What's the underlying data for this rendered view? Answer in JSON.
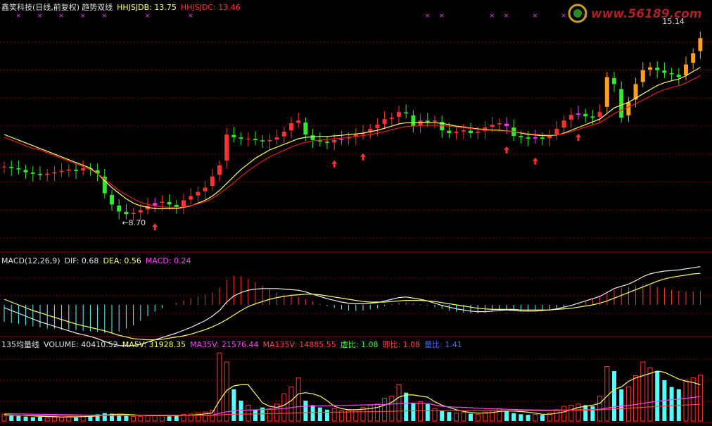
{
  "header": {
    "title": "鑫笑科技(日线,前复权)",
    "indicator": "趋势双线",
    "hhjsjdb": "HHJSJDB: 13.75",
    "hhjsjdc": "HHJSJDC: 13.46"
  },
  "macd_header": {
    "name": "MACD(12,26,9)",
    "dif": "DIF: 0.68",
    "dea": "DEA: 0.56",
    "macd": "MACD: 0.24"
  },
  "vol_header": {
    "name": "135均量线",
    "volume": "VOLUME: 40410.52",
    "ma5v": "MA5V: 31928.35",
    "ma35v": "MA35V: 21576.44",
    "ma135v": "MA135V: 14885.55",
    "xubi": "虚比: 1.08",
    "jibi": "即比: 1.08",
    "liangbi": "量比: 1.41"
  },
  "watermark": "www.56189.com",
  "colors": {
    "up": "#ff3232",
    "down": "#54ffff",
    "green_candle": "#33e833",
    "magenta": "#ff33ff",
    "orange": "#ffa020",
    "yellow_line": "#ffff66",
    "red_line": "#e02020",
    "grid": "#7a0000",
    "header_white": "#e0e0e0"
  },
  "chart_data": [
    {
      "type": "candlestick",
      "panel": "price",
      "annotations": [
        {
          "text": "8.70",
          "label": "low"
        },
        {
          "text": "15.14",
          "label": "high"
        }
      ],
      "series": [
        {
          "name": "HHJSJDB",
          "last": 13.75
        },
        {
          "name": "HHJSJDC",
          "last": 13.46
        }
      ],
      "ylim": [
        7.5,
        16.0
      ],
      "close": [
        10.55,
        10.5,
        10.45,
        10.35,
        10.3,
        10.25,
        10.3,
        10.35,
        10.4,
        10.45,
        10.4,
        10.5,
        10.45,
        10.3,
        9.6,
        9.2,
        8.95,
        8.85,
        8.9,
        9.0,
        9.15,
        9.25,
        9.3,
        9.2,
        9.1,
        9.35,
        9.5,
        9.65,
        9.8,
        10.2,
        10.6,
        11.7,
        11.6,
        11.55,
        11.55,
        11.5,
        11.45,
        11.5,
        11.6,
        11.8,
        12.1,
        12.2,
        11.7,
        11.5,
        11.45,
        11.4,
        11.5,
        11.55,
        11.6,
        11.7,
        11.75,
        11.9,
        12.05,
        12.25,
        12.3,
        12.5,
        12.45,
        12.0,
        12.2,
        12.15,
        12.2,
        11.85,
        11.75,
        11.8,
        11.85,
        11.75,
        11.8,
        11.95,
        12.05,
        12.1,
        12.0,
        11.65,
        11.6,
        11.55,
        11.6,
        11.55,
        11.65,
        11.9,
        12.2,
        12.4,
        12.45,
        12.35,
        12.3,
        12.5,
        13.75,
        13.5,
        12.3,
        12.85,
        13.5,
        14.0,
        14.1,
        14.0,
        13.9,
        13.85,
        13.75,
        14.2,
        14.6,
        15.14
      ],
      "hhjsjdb": [
        11.7,
        11.6,
        11.5,
        11.4,
        11.3,
        11.2,
        11.1,
        11.0,
        10.9,
        10.8,
        10.7,
        10.6,
        10.5,
        10.3,
        10.05,
        9.8,
        9.6,
        9.4,
        9.25,
        9.15,
        9.1,
        9.05,
        9.05,
        9.05,
        9.05,
        9.1,
        9.15,
        9.25,
        9.35,
        9.5,
        9.7,
        9.95,
        10.2,
        10.45,
        10.65,
        10.85,
        11.0,
        11.15,
        11.25,
        11.35,
        11.45,
        11.55,
        11.6,
        11.62,
        11.63,
        11.63,
        11.65,
        11.67,
        11.7,
        11.72,
        11.75,
        11.8,
        11.85,
        11.92,
        12.0,
        12.08,
        12.12,
        12.12,
        12.13,
        12.13,
        12.12,
        12.1,
        12.05,
        12.0,
        11.97,
        11.93,
        11.9,
        11.88,
        11.86,
        11.85,
        11.83,
        11.8,
        11.75,
        11.7,
        11.68,
        11.66,
        11.66,
        11.68,
        11.75,
        11.85,
        11.95,
        12.05,
        12.15,
        12.25,
        12.45,
        12.65,
        12.75,
        12.85,
        13.0,
        13.15,
        13.3,
        13.45,
        13.55,
        13.62,
        13.68,
        13.8,
        13.95,
        14.1
      ],
      "hhjsjdc": [
        11.6,
        11.5,
        11.4,
        11.3,
        11.2,
        11.15,
        11.05,
        10.95,
        10.85,
        10.75,
        10.65,
        10.55,
        10.45,
        10.3,
        10.1,
        9.9,
        9.7,
        9.55,
        9.4,
        9.28,
        9.2,
        9.15,
        9.12,
        9.1,
        9.1,
        9.12,
        9.16,
        9.22,
        9.3,
        9.42,
        9.58,
        9.78,
        9.98,
        10.2,
        10.4,
        10.58,
        10.75,
        10.9,
        11.02,
        11.14,
        11.25,
        11.35,
        11.42,
        11.47,
        11.5,
        11.52,
        11.55,
        11.57,
        11.6,
        11.63,
        11.66,
        11.7,
        11.75,
        11.8,
        11.87,
        11.93,
        11.98,
        12.0,
        12.02,
        12.03,
        12.03,
        12.02,
        12.0,
        11.97,
        11.94,
        11.91,
        11.88,
        11.86,
        11.84,
        11.83,
        11.82,
        11.8,
        11.77,
        11.73,
        11.71,
        11.69,
        11.68,
        11.69,
        11.73,
        11.8,
        11.88,
        11.96,
        12.04,
        12.12,
        12.28,
        12.45,
        12.57,
        12.68,
        12.8,
        12.93,
        13.06,
        13.2,
        13.3,
        13.38,
        13.44,
        13.54,
        13.67,
        13.8
      ]
    },
    {
      "type": "bar",
      "panel": "macd",
      "dif_last": 0.68,
      "dea_last": 0.56,
      "macd_last": 0.24,
      "macd": [
        -0.3,
        -0.32,
        -0.34,
        -0.36,
        -0.38,
        -0.4,
        -0.42,
        -0.42,
        -0.44,
        -0.44,
        -0.45,
        -0.46,
        -0.47,
        -0.48,
        -0.5,
        -0.5,
        -0.47,
        -0.42,
        -0.36,
        -0.28,
        -0.2,
        -0.12,
        -0.06,
        0.0,
        0.04,
        0.08,
        0.12,
        0.15,
        0.18,
        0.22,
        0.3,
        0.45,
        0.52,
        0.5,
        0.46,
        0.4,
        0.34,
        0.28,
        0.22,
        0.18,
        0.16,
        0.14,
        0.1,
        0.06,
        0.02,
        -0.02,
        -0.05,
        -0.08,
        -0.1,
        -0.11,
        -0.1,
        -0.08,
        -0.06,
        -0.02,
        0.02,
        0.04,
        0.05,
        0.03,
        0.01,
        -0.01,
        -0.04,
        -0.07,
        -0.1,
        -0.12,
        -0.14,
        -0.15,
        -0.15,
        -0.14,
        -0.12,
        -0.1,
        -0.09,
        -0.1,
        -0.11,
        -0.11,
        -0.1,
        -0.09,
        -0.08,
        -0.06,
        -0.04,
        -0.02,
        0.02,
        0.06,
        0.1,
        0.14,
        0.2,
        0.26,
        0.3,
        0.32,
        0.34,
        0.36,
        0.35,
        0.32,
        0.3,
        0.27,
        0.25,
        0.24,
        0.24,
        0.24
      ],
      "dif": [
        -0.05,
        -0.1,
        -0.15,
        -0.2,
        -0.25,
        -0.3,
        -0.34,
        -0.38,
        -0.42,
        -0.46,
        -0.5,
        -0.53,
        -0.56,
        -0.6,
        -0.65,
        -0.69,
        -0.72,
        -0.73,
        -0.72,
        -0.7,
        -0.66,
        -0.62,
        -0.58,
        -0.54,
        -0.5,
        -0.45,
        -0.4,
        -0.34,
        -0.28,
        -0.2,
        -0.1,
        0.05,
        0.16,
        0.22,
        0.26,
        0.28,
        0.29,
        0.29,
        0.29,
        0.28,
        0.27,
        0.26,
        0.23,
        0.19,
        0.15,
        0.11,
        0.08,
        0.05,
        0.03,
        0.02,
        0.02,
        0.03,
        0.04,
        0.07,
        0.1,
        0.13,
        0.14,
        0.12,
        0.1,
        0.07,
        0.03,
        -0.01,
        -0.04,
        -0.07,
        -0.09,
        -0.11,
        -0.12,
        -0.12,
        -0.11,
        -0.1,
        -0.09,
        -0.1,
        -0.11,
        -0.11,
        -0.11,
        -0.1,
        -0.09,
        -0.07,
        -0.04,
        -0.01,
        0.03,
        0.07,
        0.11,
        0.15,
        0.22,
        0.29,
        0.33,
        0.37,
        0.43,
        0.5,
        0.55,
        0.58,
        0.6,
        0.61,
        0.62,
        0.64,
        0.66,
        0.68
      ],
      "dea": [
        0.1,
        0.05,
        0.0,
        -0.05,
        -0.1,
        -0.14,
        -0.18,
        -0.22,
        -0.26,
        -0.3,
        -0.34,
        -0.37,
        -0.4,
        -0.43,
        -0.46,
        -0.5,
        -0.54,
        -0.57,
        -0.6,
        -0.61,
        -0.62,
        -0.62,
        -0.61,
        -0.59,
        -0.57,
        -0.55,
        -0.52,
        -0.48,
        -0.44,
        -0.39,
        -0.33,
        -0.26,
        -0.18,
        -0.1,
        -0.03,
        0.02,
        0.06,
        0.1,
        0.13,
        0.15,
        0.17,
        0.18,
        0.19,
        0.19,
        0.18,
        0.16,
        0.14,
        0.12,
        0.1,
        0.08,
        0.06,
        0.05,
        0.05,
        0.05,
        0.06,
        0.07,
        0.08,
        0.08,
        0.08,
        0.07,
        0.06,
        0.04,
        0.02,
        0.0,
        -0.02,
        -0.04,
        -0.06,
        -0.07,
        -0.08,
        -0.08,
        -0.08,
        -0.08,
        -0.09,
        -0.09,
        -0.09,
        -0.09,
        -0.09,
        -0.08,
        -0.07,
        -0.06,
        -0.04,
        -0.02,
        0.0,
        0.03,
        0.07,
        0.12,
        0.17,
        0.22,
        0.27,
        0.32,
        0.37,
        0.42,
        0.46,
        0.49,
        0.51,
        0.53,
        0.55,
        0.56
      ]
    },
    {
      "type": "bar",
      "panel": "volume",
      "volume_last": 40410.52,
      "ma5v_last": 31928.35,
      "ma35v_last": 21576.44,
      "ma135v_last": 14885.55,
      "volume": [
        6000,
        5000,
        4500,
        4000,
        3500,
        3800,
        3000,
        4000,
        3500,
        3800,
        3200,
        5000,
        4200,
        6000,
        7000,
        6500,
        5500,
        4500,
        4000,
        4200,
        4600,
        5000,
        4800,
        4200,
        4500,
        6000,
        6200,
        7000,
        8000,
        9500,
        60000,
        52000,
        28000,
        18000,
        14000,
        10000,
        12000,
        11000,
        15000,
        24000,
        30000,
        38000,
        18000,
        14000,
        12000,
        10000,
        11000,
        9000,
        9500,
        10000,
        12000,
        14000,
        15000,
        20000,
        22000,
        32000,
        25000,
        16000,
        17000,
        15000,
        11000,
        9000,
        8000,
        7000,
        7500,
        6500,
        6000,
        8000,
        9000,
        11000,
        9000,
        7000,
        6000,
        5500,
        6000,
        5500,
        7000,
        10000,
        13000,
        14000,
        15000,
        14000,
        13000,
        22000,
        48000,
        44000,
        28000,
        30000,
        40000,
        52000,
        47000,
        44000,
        36000,
        30000,
        28000,
        36000,
        38000,
        40410
      ],
      "ma5v": [
        5500,
        5400,
        5200,
        4800,
        4600,
        4300,
        4000,
        3800,
        3600,
        3700,
        3700,
        3900,
        4100,
        4500,
        5200,
        5800,
        6100,
        5900,
        5500,
        5100,
        4800,
        4700,
        4700,
        4800,
        4700,
        5000,
        5200,
        5700,
        6300,
        7200,
        18000,
        27000,
        31000,
        32000,
        32000,
        24000,
        16000,
        13000,
        12000,
        14000,
        18000,
        24000,
        25000,
        24000,
        22000,
        18000,
        13000,
        11000,
        10000,
        10000,
        10400,
        11000,
        12000,
        14000,
        16500,
        21000,
        23000,
        23000,
        22000,
        21000,
        17000,
        14000,
        12000,
        10000,
        8500,
        7500,
        7000,
        7000,
        7500,
        8500,
        8800,
        8800,
        8400,
        7800,
        7000,
        6000,
        6000,
        7000,
        8000,
        10000,
        12000,
        13000,
        14000,
        15600,
        22000,
        28000,
        30000,
        35000,
        38000,
        40000,
        42000,
        44000,
        43000,
        40000,
        37000,
        35000,
        34000,
        31928
      ],
      "ma35v": [
        6500,
        6400,
        6300,
        6200,
        6100,
        6000,
        5900,
        5800,
        5700,
        5600,
        5500,
        5400,
        5300,
        5300,
        5300,
        5300,
        5200,
        5200,
        5100,
        5100,
        5000,
        5000,
        5000,
        5000,
        5000,
        5000,
        5000,
        5100,
        5200,
        5300,
        6800,
        8200,
        9000,
        9400,
        9700,
        9900,
        10100,
        10300,
        10600,
        11100,
        11800,
        12700,
        13000,
        13200,
        13400,
        13500,
        13700,
        13800,
        13900,
        14000,
        14200,
        14300,
        14500,
        14700,
        15000,
        15500,
        15800,
        15800,
        15800,
        15600,
        14200,
        13000,
        12600,
        12300,
        12100,
        11700,
        11300,
        11000,
        10800,
        10600,
        10400,
        10200,
        10000,
        9900,
        9800,
        9700,
        9700,
        9700,
        9700,
        9800,
        9900,
        10000,
        10100,
        10400,
        11500,
        12600,
        13200,
        13800,
        14600,
        15700,
        16600,
        17500,
        18200,
        18800,
        19300,
        20100,
        20800,
        21576
      ],
      "ma135v": [
        5000,
        5000,
        5000,
        5000,
        5000,
        5000,
        5000,
        5000,
        5000,
        5000,
        5000,
        5000,
        5000,
        5000,
        5000,
        5000,
        5000,
        5000,
        5000,
        5000,
        5000,
        5000,
        5000,
        5000,
        5000,
        5000,
        5000,
        5000,
        5000,
        5000,
        5400,
        5800,
        6000,
        6100,
        6200,
        6300,
        6400,
        6500,
        6600,
        6800,
        7000,
        7300,
        7400,
        7500,
        7600,
        7700,
        7800,
        7900,
        8000,
        8100,
        8200,
        8300,
        8400,
        8500,
        8600,
        8800,
        8900,
        9000,
        9100,
        9200,
        9200,
        9200,
        9200,
        9200,
        9200,
        9200,
        9200,
        9200,
        9200,
        9200,
        9200,
        9200,
        9200,
        9200,
        9200,
        9200,
        9200,
        9300,
        9400,
        9500,
        9600,
        9700,
        9800,
        9900,
        10300,
        10700,
        11000,
        11300,
        11700,
        12100,
        12500,
        12900,
        13200,
        13500,
        13800,
        14200,
        14500,
        14885
      ]
    }
  ]
}
